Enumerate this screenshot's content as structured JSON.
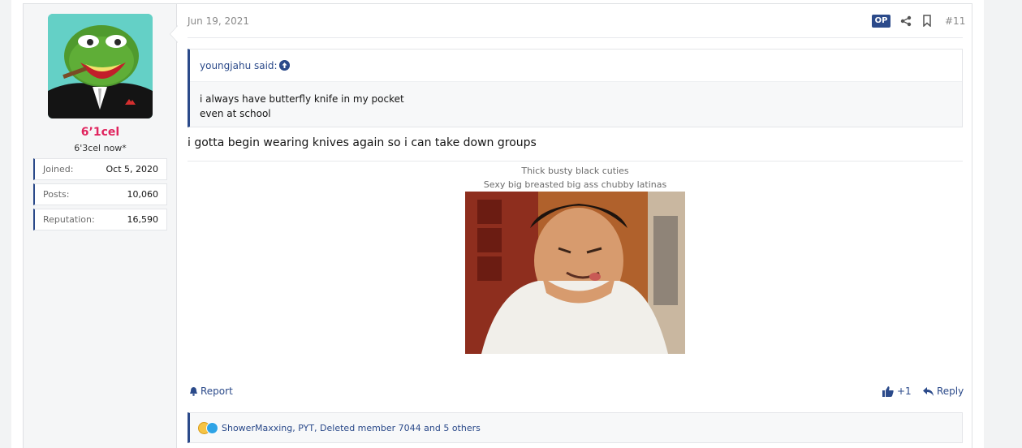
{
  "user": {
    "name": "6’1cel",
    "title": "6'3cel now*",
    "stats": [
      {
        "label": "Joined:",
        "value": "Oct 5, 2020"
      },
      {
        "label": "Posts:",
        "value": "10,060"
      },
      {
        "label": "Reputation:",
        "value": "16,590"
      }
    ]
  },
  "post": {
    "date": "Jun 19, 2021",
    "op_badge": "OP",
    "number": "#11",
    "quote": {
      "author": "youngjahu said:",
      "lines": [
        "i always have butterfly knife in my pocket",
        "even at school"
      ]
    },
    "message": "i gotta begin wearing knives again so i can take down groups",
    "signature": {
      "line1": "Thick busty black cuties",
      "line2": "Sexy big breasted big ass chubby latinas"
    },
    "actions": {
      "report": "Report",
      "like_count": "+1",
      "reply": "Reply"
    },
    "reactions_text": "ShowerMaxxing, PYT, Deleted member 7044 and 5 others"
  },
  "colors": {
    "accent": "#2b4a8a",
    "username": "#e0245e"
  }
}
